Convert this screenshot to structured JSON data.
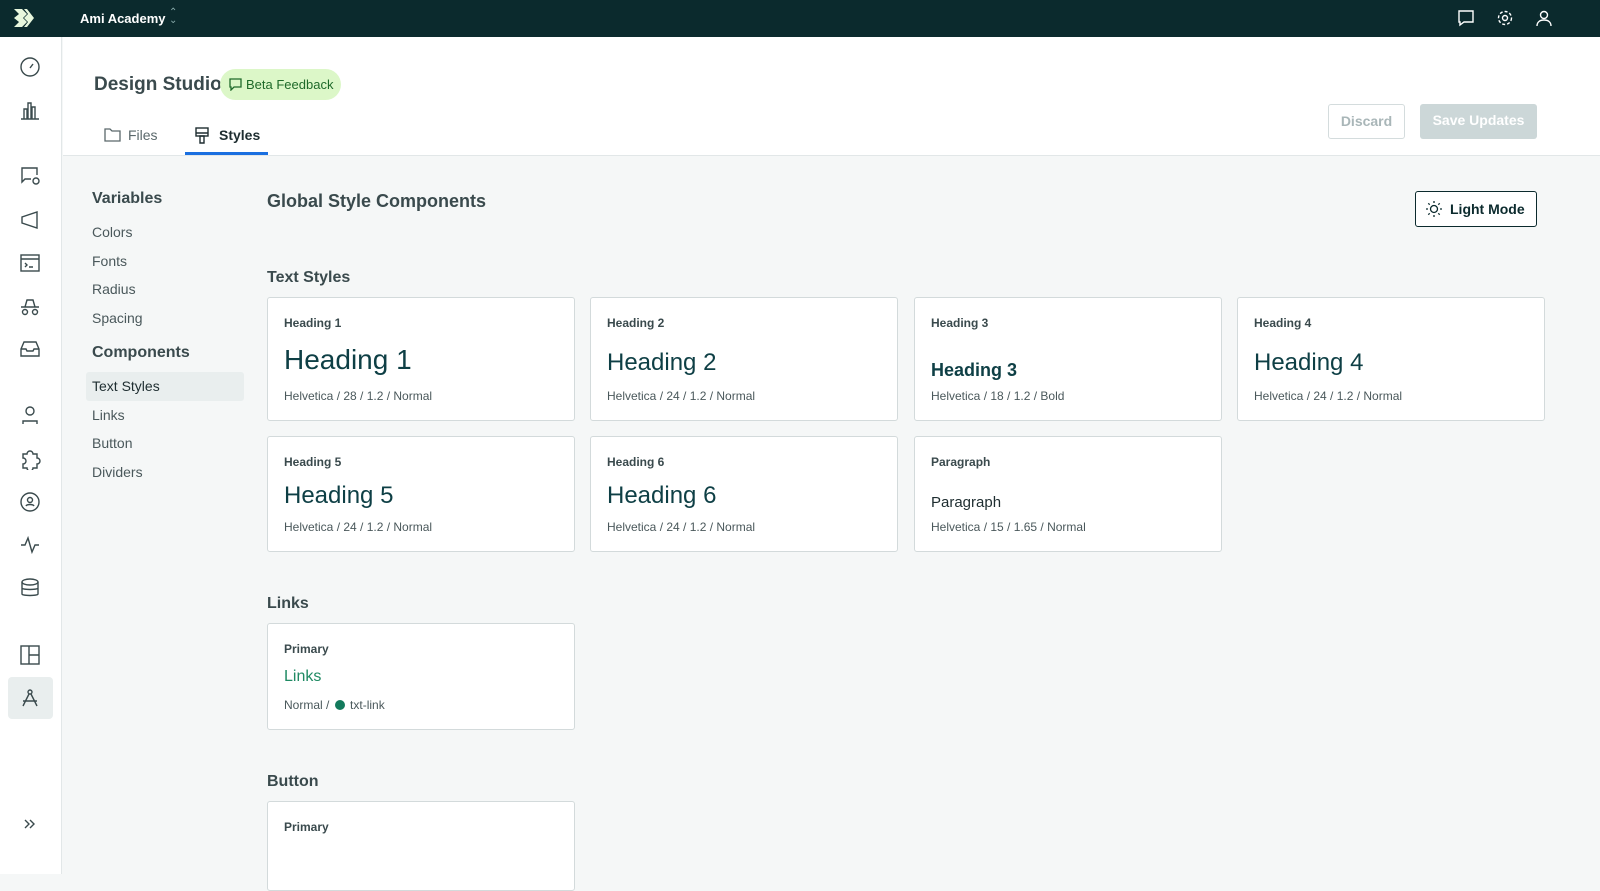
{
  "topbar": {
    "org": "Ami Academy",
    "icons": [
      "chat-icon",
      "gear-icon",
      "user-icon"
    ]
  },
  "header": {
    "title": "Design Studio",
    "beta": "Beta Feedback",
    "tabs": [
      {
        "label": "Files"
      },
      {
        "label": "Styles"
      }
    ],
    "discard": "Discard",
    "save": "Save Updates"
  },
  "leftnav": {
    "variables_title": "Variables",
    "variables": [
      "Colors",
      "Fonts",
      "Radius",
      "Spacing"
    ],
    "components_title": "Components",
    "components": [
      "Text Styles",
      "Links",
      "Button",
      "Dividers"
    ]
  },
  "main": {
    "title": "Global Style Components",
    "mode_button": "Light Mode",
    "text_styles_title": "Text Styles",
    "text_styles": [
      {
        "label": "Heading 1",
        "sample": "Heading 1",
        "meta": "Helvetica / 28 / 1.2 / Normal"
      },
      {
        "label": "Heading 2",
        "sample": "Heading 2",
        "meta": "Helvetica / 24 / 1.2 / Normal"
      },
      {
        "label": "Heading 3",
        "sample": "Heading 3",
        "meta": "Helvetica / 18 / 1.2 / Bold"
      },
      {
        "label": "Heading 4",
        "sample": "Heading 4",
        "meta": "Helvetica / 24 / 1.2 / Normal"
      },
      {
        "label": "Heading 5",
        "sample": "Heading 5",
        "meta": "Helvetica / 24 / 1.2 / Normal"
      },
      {
        "label": "Heading 6",
        "sample": "Heading 6",
        "meta": "Helvetica / 24 / 1.2 / Normal"
      },
      {
        "label": "Paragraph",
        "sample": "Paragraph",
        "meta": "Helvetica / 15 / 1.65 / Normal"
      }
    ],
    "links_title": "Links",
    "link_card": {
      "label": "Primary",
      "sample": "Links",
      "meta_prefix": "Normal /",
      "token": "txt-link",
      "color": "#137a5c"
    },
    "button_title": "Button",
    "button_card": {
      "label": "Primary"
    }
  }
}
